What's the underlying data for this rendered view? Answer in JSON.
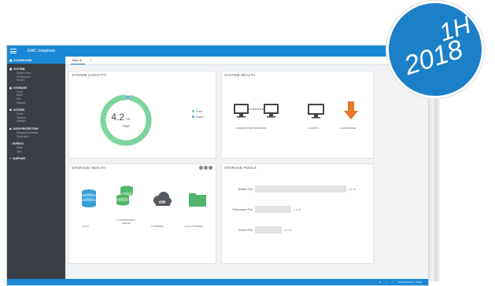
{
  "app": {
    "title": "EMC Unisphere"
  },
  "badge": {
    "line1": "1H",
    "line2": "2018"
  },
  "sidebar": {
    "dashboard": "DASHBOARD",
    "sections": [
      {
        "title": "SYSTEM",
        "icon": "server-icon",
        "items": [
          "System View",
          "Performance",
          "Service"
        ]
      },
      {
        "title": "STORAGE",
        "icon": "database-icon",
        "items": [
          "Pools",
          "Block",
          "File",
          "VMware"
        ]
      },
      {
        "title": "ACCESS",
        "icon": "link-icon",
        "items": [
          "Hosts",
          "VMware",
          "Initiators"
        ]
      },
      {
        "title": "DATA PROTECTION",
        "icon": "shield-icon",
        "items": [
          "Snapshot Schedule",
          "Replication"
        ]
      },
      {
        "title": "EVENTS",
        "icon": "bell-icon",
        "items": [
          "Alerts",
          "Jobs"
        ]
      },
      {
        "title": "SUPPORT",
        "icon": "question-icon",
        "items": []
      }
    ]
  },
  "tabs": {
    "main_label": "Main",
    "add_label": "+"
  },
  "system_capacity": {
    "title": "SYSTEM CAPACITY",
    "total_value": "4.2",
    "total_unit": "TB",
    "total_label": "Total",
    "free_fraction": 0.97,
    "legend": [
      {
        "label": "Free",
        "color": "#7ed4a0"
      },
      {
        "label": "Used",
        "color": "#7aaed8"
      }
    ]
  },
  "system_health": {
    "title": "SYSTEM HEALTH",
    "items": [
      {
        "label": "3  REPLICATION SESSIONS",
        "icon": "replication-icon"
      },
      {
        "label": "0  HOSTS",
        "icon": "monitor-icon"
      },
      {
        "label": "2  HARDWARE",
        "icon": "arrow-down-icon"
      }
    ]
  },
  "storage_health": {
    "title": "STORAGE HEALTH",
    "items": [
      {
        "label": "3  LUN",
        "icon": "lun-icon",
        "color": "#3aa0d8"
      },
      {
        "label": "1  CONSISTENCY GROUP",
        "icon": "consistency-group-icon",
        "color": "#52b56a"
      },
      {
        "label": "3  VDWARE",
        "icon": "vmware-cloud-icon",
        "color": "#555a60"
      },
      {
        "label": "1  FILE SYSTEMS",
        "icon": "folder-icon",
        "color": "#52b56a"
      }
    ]
  },
  "storage_pools": {
    "title": "STORAGE POOLS",
    "pools": [
      {
        "name": "Multitier Pool",
        "value": "2.8 TB",
        "fraction": 0.95
      },
      {
        "name": "Performance Pool",
        "value": "1.4 TB",
        "fraction": 0.38
      },
      {
        "name": "Archive Pool",
        "value": "0.7 TB",
        "fraction": 0.28
      }
    ]
  },
  "statusbar": {
    "time": "9:08 AM (UTC) - 04:00",
    "icons": [
      "tools-icon",
      "alert-icon",
      "info-icon"
    ]
  },
  "colors": {
    "accent": "#1b88d6",
    "sidebar": "#3a3f46",
    "green": "#7ed4a0",
    "orange": "#e8782a"
  }
}
